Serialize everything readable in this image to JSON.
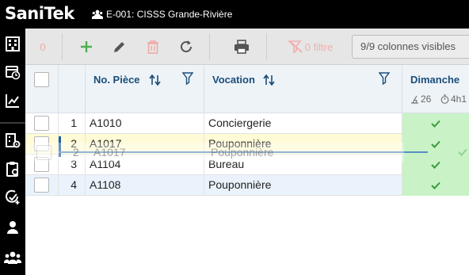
{
  "app": {
    "logo": "SaniTek",
    "crumb": "E-001: CISSS Grande-Rivière"
  },
  "toolbar": {
    "selected_count": "0",
    "filter_label": "0 filtre",
    "columns_label": "9/9 colonnes visibles"
  },
  "grid": {
    "columns": {
      "no_piece": "No. Pièce",
      "vocation": "Vocation",
      "dimanche": "Dimanche",
      "dimanche_count": "26",
      "dimanche_time": "4h1"
    },
    "rows": [
      {
        "index": "1",
        "no_piece": "A1010",
        "vocation": "Conciergerie"
      },
      {
        "index": "2",
        "no_piece": "A1017",
        "vocation": "Pouponnière"
      },
      {
        "index": "3",
        "no_piece": "A1104",
        "vocation": "Bureau"
      },
      {
        "index": "4",
        "no_piece": "A1108",
        "vocation": "Pouponnière"
      }
    ],
    "drag_ghost": {
      "index": "2",
      "no_piece": "A1017",
      "vocation": "Pouponnière"
    }
  },
  "colors": {
    "accent": "#1a4e7a",
    "add": "#4caf50",
    "delete": "#f0a9a9",
    "day_cell": "#c9f2c7",
    "highlight_row": "#fffbd6",
    "hover_row": "#eaf3fb"
  }
}
